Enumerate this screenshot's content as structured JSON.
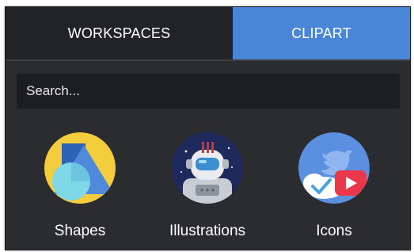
{
  "tabs": {
    "workspaces_label": "WORKSPACES",
    "clipart_label": "CLIPART",
    "active": "CLIPART"
  },
  "search": {
    "placeholder": "Search...",
    "value": ""
  },
  "categories": [
    {
      "label": "Shapes",
      "icon": "shapes-icon"
    },
    {
      "label": "Illustrations",
      "icon": "astronaut-icon"
    },
    {
      "label": "Icons",
      "icon": "bird-play-icon"
    }
  ],
  "colors": {
    "panel_bg": "#2b2c2f",
    "tab_inactive_bg": "#222326",
    "tab_active_bg": "#4a86d7",
    "search_bg": "#1d1e20",
    "text": "#ffffff"
  }
}
